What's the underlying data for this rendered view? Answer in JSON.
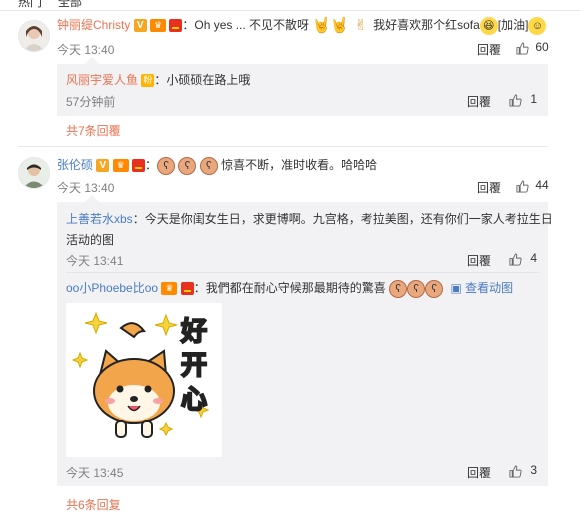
{
  "tabs": {
    "hot": "热门",
    "all": "全部"
  },
  "comments": [
    {
      "user": "钟丽缇Christy",
      "text_a": "：Oh yes ... 不见不散呀",
      "text_b": "我好喜欢那个红sofa",
      "emoji_label": "[加油]",
      "time": "今天 13:40",
      "reply_label": "回覆",
      "likes": "60",
      "reply": {
        "user": "风丽宇爱人鱼",
        "text": "：小硕硕在路上哦",
        "time": "57分钟前",
        "reply_label": "回覆",
        "likes": "1"
      },
      "more_label": "共7条回覆"
    },
    {
      "user": "张伦硕",
      "text": "惊喜不断，准时收看。哈哈哈",
      "time": "今天 13:40",
      "reply_label": "回覆",
      "likes": "44",
      "replies": [
        {
          "user": "上善若水xbs",
          "text_line1": "：今天是你闺女生日，求更博啊。九宫格，考拉美图，还有你们一家人考拉生日",
          "text_line2": "活动的图",
          "time": "今天 13:41",
          "reply_label": "回覆",
          "likes": "4"
        },
        {
          "user": "oo小Phoebe比oo",
          "text": "：我們都在耐心守候那最期待的驚喜",
          "view_gif": "查看动图",
          "sticker_text": "好开心",
          "time": "今天 13:45",
          "reply_label": "回覆",
          "likes": "3"
        }
      ],
      "more_label": "共6条回复"
    }
  ]
}
